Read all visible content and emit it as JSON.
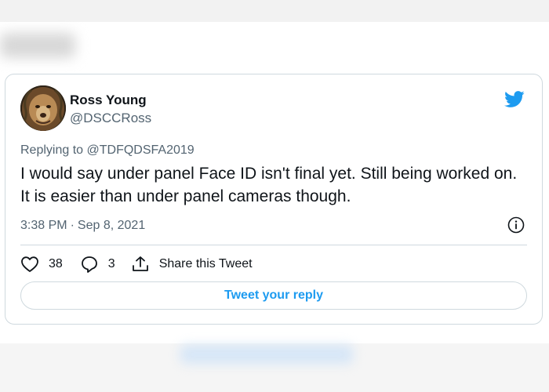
{
  "tweet": {
    "author_name": "Ross Young",
    "author_handle": "@DSCCRoss",
    "replying_to": "Replying to @TDFQDSFA2019",
    "text": "I would say under panel Face ID isn't final yet. Still being worked on. It is easier than under panel cameras though.",
    "time": "3:38 PM",
    "date": "Sep 8, 2021",
    "separator": "·",
    "likes": "38",
    "replies": "3",
    "share_label": "Share this Tweet",
    "reply_button_label": "Tweet your reply"
  },
  "icons": {
    "brand": "twitter-bird-icon",
    "info": "info-icon",
    "like": "heart-icon",
    "reply": "reply-bubble-icon",
    "share": "share-icon"
  },
  "colors": {
    "brand_blue": "#1d9bf0",
    "text_primary": "#0f1419",
    "text_secondary": "#536471",
    "border": "#cfd9de"
  }
}
